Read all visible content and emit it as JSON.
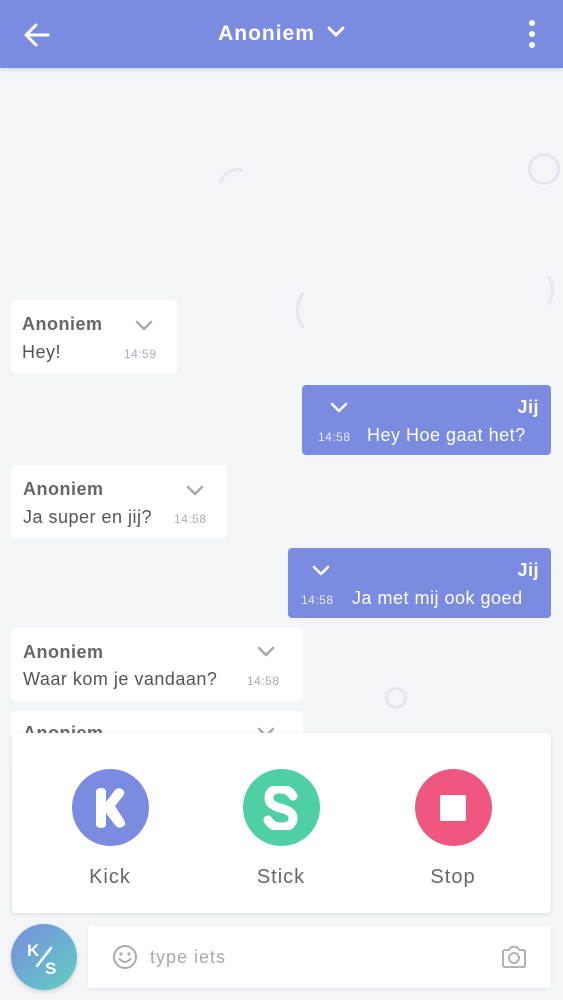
{
  "header": {
    "title": "Anoniem",
    "back_icon": "arrow-left-icon",
    "dropdown_icon": "chevron-down-icon",
    "menu_icon": "more-vertical-icon",
    "color": "#7a8be0"
  },
  "messages": [
    {
      "sender": "Anoniem",
      "text": "Hey!",
      "time": "14:59",
      "direction": "in"
    },
    {
      "sender": "Jij",
      "text": "Hey Hoe gaat het?",
      "time": "14:58",
      "direction": "out"
    },
    {
      "sender": "Anoniem",
      "text": "Ja super en jij?",
      "time": "14:58",
      "direction": "in"
    },
    {
      "sender": "Jij",
      "text": "Ja met mij ook goed",
      "time": "14:58",
      "direction": "out"
    },
    {
      "sender": "Anoniem",
      "text": "Waar kom je vandaan?",
      "time": "14:58",
      "direction": "in"
    },
    {
      "sender": "Anoniem",
      "text": "",
      "time": "",
      "direction": "in"
    }
  ],
  "actions": [
    {
      "label": "Kick",
      "icon": "kick-k-icon",
      "color": "#7a8be0"
    },
    {
      "label": "Stick",
      "icon": "stick-s-icon",
      "color": "#4fcfa6"
    },
    {
      "label": "Stop",
      "icon": "stop-square-icon",
      "color": "#f0577f"
    }
  ],
  "composer": {
    "placeholder": "type iets",
    "value": "",
    "emoji_icon": "smiley-icon",
    "camera_icon": "camera-icon",
    "ks_button_icon": "ks-logo-icon"
  }
}
